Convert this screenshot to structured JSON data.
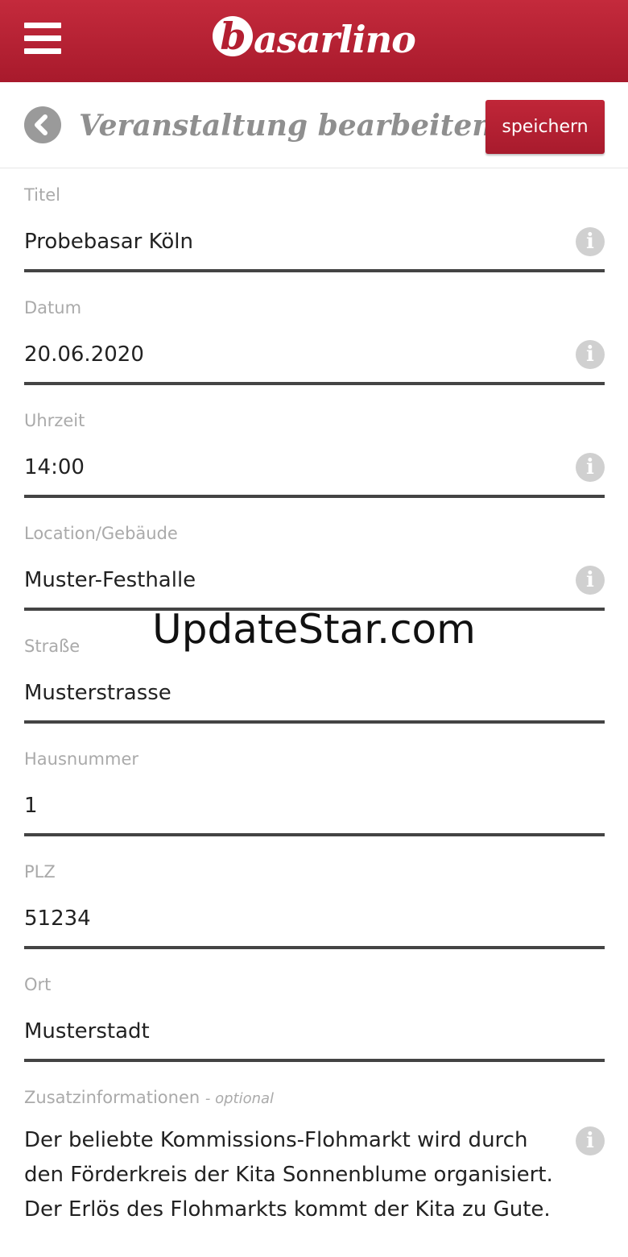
{
  "app": {
    "logo_text": "basarlino",
    "logo_badge": "b",
    "logo_rest": "asarlino"
  },
  "header": {
    "title": "Veranstaltung bearbeiten",
    "save_label": "speichern"
  },
  "fields": [
    {
      "label": "Titel",
      "value": "Probebasar Köln",
      "info": true
    },
    {
      "label": "Datum",
      "value": "20.06.2020",
      "info": true
    },
    {
      "label": "Uhrzeit",
      "value": "14:00",
      "info": true
    },
    {
      "label": "Location/Gebäude",
      "value": "Muster-Festhalle",
      "info": true
    },
    {
      "label": "Straße",
      "value": "Musterstrasse",
      "info": false
    },
    {
      "label": "Hausnummer",
      "value": "1",
      "info": false
    },
    {
      "label": "PLZ",
      "value": "51234",
      "info": false
    },
    {
      "label": "Ort",
      "value": "Musterstadt",
      "info": false
    }
  ],
  "extra": {
    "label": "Zusatzinformationen",
    "optional": "- optional",
    "text": "Der beliebte Kommissions-Flohmarkt wird durch den Förderkreis der Kita Sonnenblume organisiert. Der Erlös des Flohmarkts kommt der Kita zu Gute."
  },
  "info_glyph": "i",
  "watermark": "UpdateStar.com",
  "colors": {
    "brand": "#b31f31",
    "label": "#aaaaaa",
    "line": "#444444",
    "info": "#d0d0d0"
  }
}
